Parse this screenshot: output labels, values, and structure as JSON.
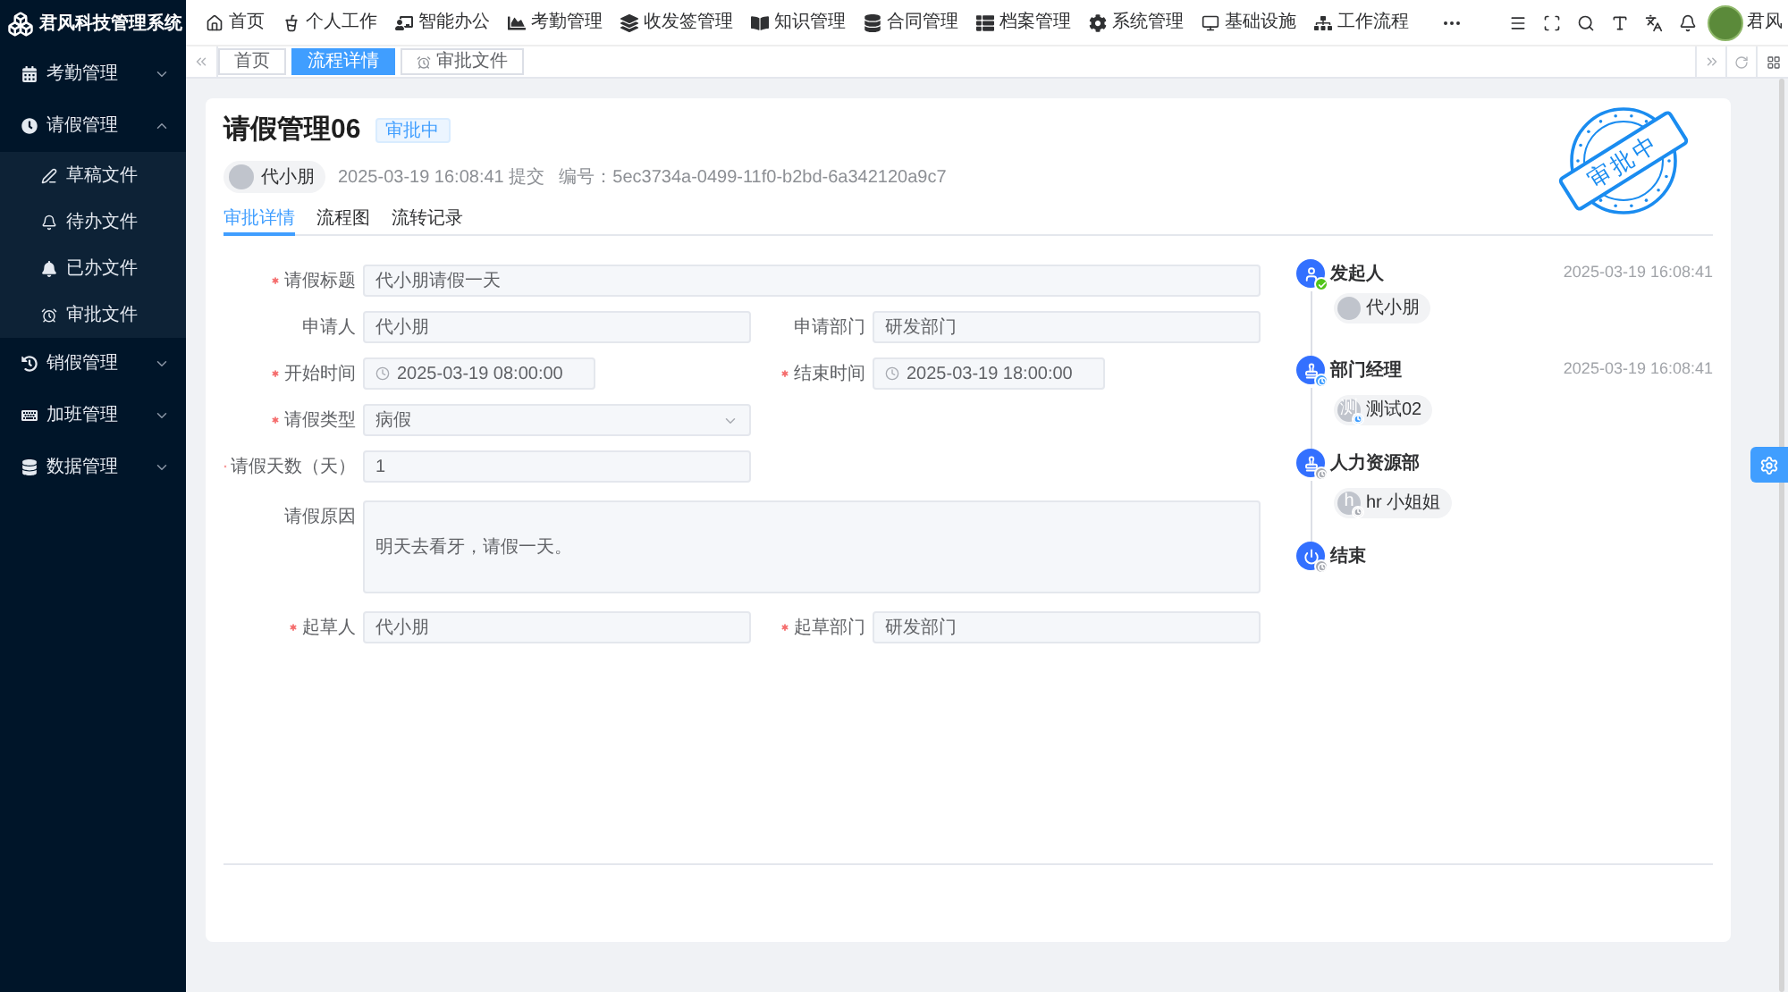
{
  "sidebar": {
    "logo": "君风科技管理系统",
    "items": [
      {
        "label": "考勤管理",
        "expanded": false
      },
      {
        "label": "请假管理",
        "expanded": true,
        "children": [
          {
            "label": "草稿文件"
          },
          {
            "label": "待办文件"
          },
          {
            "label": "已办文件"
          },
          {
            "label": "审批文件"
          }
        ]
      },
      {
        "label": "销假管理",
        "expanded": false
      },
      {
        "label": "加班管理",
        "expanded": false
      },
      {
        "label": "数据管理",
        "expanded": false
      }
    ]
  },
  "top_nav": {
    "items": [
      {
        "label": "首页"
      },
      {
        "label": "个人工作"
      },
      {
        "label": "智能办公"
      },
      {
        "label": "考勤管理"
      },
      {
        "label": "收发签管理"
      },
      {
        "label": "知识管理"
      },
      {
        "label": "合同管理"
      },
      {
        "label": "档案管理"
      },
      {
        "label": "系统管理"
      },
      {
        "label": "基础设施"
      },
      {
        "label": "工作流程"
      }
    ],
    "user": {
      "name": "君风"
    }
  },
  "tab_bar": {
    "tabs": [
      {
        "label": "首页",
        "selected": false
      },
      {
        "label": "流程详情",
        "selected": true
      },
      {
        "label": "审批文件",
        "selected": false
      }
    ]
  },
  "detail": {
    "title": "请假管理06",
    "status": "审批中",
    "submitter": "代小朋",
    "submitted": "2025-03-19 16:08:41 提交",
    "serial": "编号：5ec3734a-0499-11f0-b2bd-6a342120a9c7",
    "tabs": [
      {
        "label": "审批详情",
        "selected": true
      },
      {
        "label": "流程图",
        "selected": false
      },
      {
        "label": "流转记录",
        "selected": false
      }
    ],
    "stamp": "审批中"
  },
  "form": {
    "rows": [
      [
        {
          "label": "请假标题",
          "required": true,
          "kind": "text",
          "value": "代小朋请假一天"
        }
      ],
      [
        {
          "label": "申请人",
          "required": false,
          "kind": "text",
          "value": "代小朋"
        },
        {
          "label": "申请部门",
          "required": false,
          "kind": "text",
          "value": "研发部门"
        }
      ],
      [
        {
          "label": "开始时间",
          "required": true,
          "kind": "date",
          "value": "2025-03-19 08:00:00"
        },
        {
          "label": "结束时间",
          "required": true,
          "kind": "date",
          "value": "2025-03-19 18:00:00"
        }
      ],
      [
        {
          "label": "请假类型",
          "required": true,
          "kind": "select",
          "value": "病假"
        }
      ],
      [
        {
          "label": "请假天数（天）",
          "required": true,
          "kind": "text",
          "value": "1"
        }
      ],
      [
        {
          "label": "请假原因",
          "required": false,
          "kind": "textarea",
          "value": "明天去看牙，请假一天。"
        }
      ],
      [
        {
          "label": "起草人",
          "required": true,
          "kind": "text",
          "value": "代小朋"
        },
        {
          "label": "起草部门",
          "required": true,
          "kind": "text",
          "value": "研发部门"
        }
      ]
    ]
  },
  "timeline": {
    "nodes": [
      {
        "kind": "start",
        "role": "发起人",
        "completed": true,
        "color": "#52c41a",
        "time": "2025-03-19 16:08:41",
        "person": {
          "name": "代小朋"
        }
      },
      {
        "kind": "approver",
        "role": "部门经理",
        "completed": false,
        "color": "#409eff",
        "time": "2025-03-19 16:08:41",
        "person": {
          "name": "测试02",
          "avatar_text": "测",
          "color": "#409eff"
        }
      },
      {
        "kind": "approver",
        "role": "人力资源部",
        "completed": false,
        "color": "#a8abb2",
        "person": {
          "name": "hr 小姐姐",
          "avatar_text": "h",
          "color": "#a8abb2"
        }
      },
      {
        "kind": "end",
        "role": "结束",
        "completed": false,
        "color": "#a8abb2"
      }
    ]
  }
}
